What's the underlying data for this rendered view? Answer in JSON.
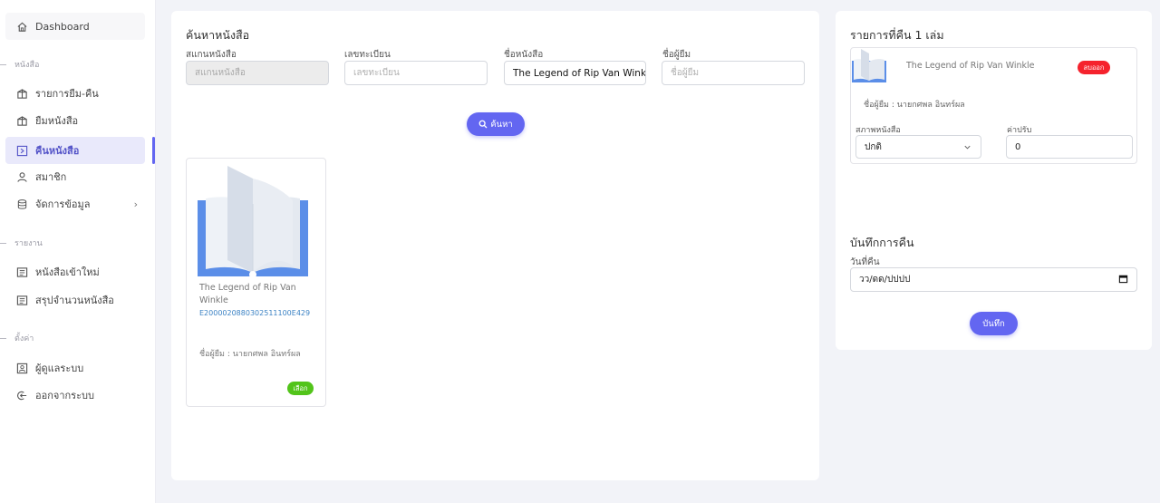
{
  "sidebar": {
    "dashboard": "Dashboard",
    "section_books": "หนังสือ",
    "items_books": [
      "รายการยืม-คืน",
      "ยืมหนังสือ",
      "คืนหนังสือ",
      "สมาชิก",
      "จัดการข้อมูล"
    ],
    "section_reports": "รายงาน",
    "items_reports": [
      "หนังสือเข้าใหม่",
      "สรุปจำนวนหนังสือ"
    ],
    "section_settings": "ตั้งค่า",
    "items_settings": [
      "ผู้ดูแลระบบ",
      "ออกจากระบบ"
    ],
    "active_item": "คืนหนังสือ"
  },
  "search": {
    "title": "ค้นหาหนังสือ",
    "scan_label": "สแกนหนังสือ",
    "scan_placeholder": "สแกนหนังสือ",
    "reg_label": "เลขทะเบียน",
    "reg_placeholder": "เลขทะเบียน",
    "name_label": "ชื่อหนังสือ",
    "name_value": "The Legend of Rip Van Winkle",
    "borrower_label": "ชื่อผู้ยืม",
    "borrower_placeholder": "ชื่อผู้ยืม",
    "search_button": "ค้นหา"
  },
  "results": [
    {
      "title": "The Legend of Rip Van Winkle",
      "code": "E2000020880302511100E429",
      "borrower": "ชื่อผู้ยืม : นายกศพล อินทร์ผล",
      "select_label": "เลือก"
    }
  ],
  "return_list": {
    "title": "รายการที่คืน 1 เล่ม",
    "item": {
      "title": "The Legend of Rip Van Winkle",
      "remove_label": "ลบออก",
      "borrower": "ชื่อผู้ยืม : นายกศพล อินทร์ผล",
      "condition_label": "สภาพหนังสือ",
      "condition_value": "ปกติ",
      "fine_label": "ค่าปรับ",
      "fine_value": "0"
    }
  },
  "record": {
    "title": "บันทึกการคืน",
    "date_label": "วันที่คืน",
    "date_placeholder": "วว/ดด/ปปปป",
    "save_button": "บันทึก"
  },
  "colors": {
    "accent": "#6366f1",
    "active_bg": "#e9e9fb",
    "select_pill": "#52c41a",
    "remove_pill": "#f5222d",
    "link_code": "#3b82c4"
  }
}
